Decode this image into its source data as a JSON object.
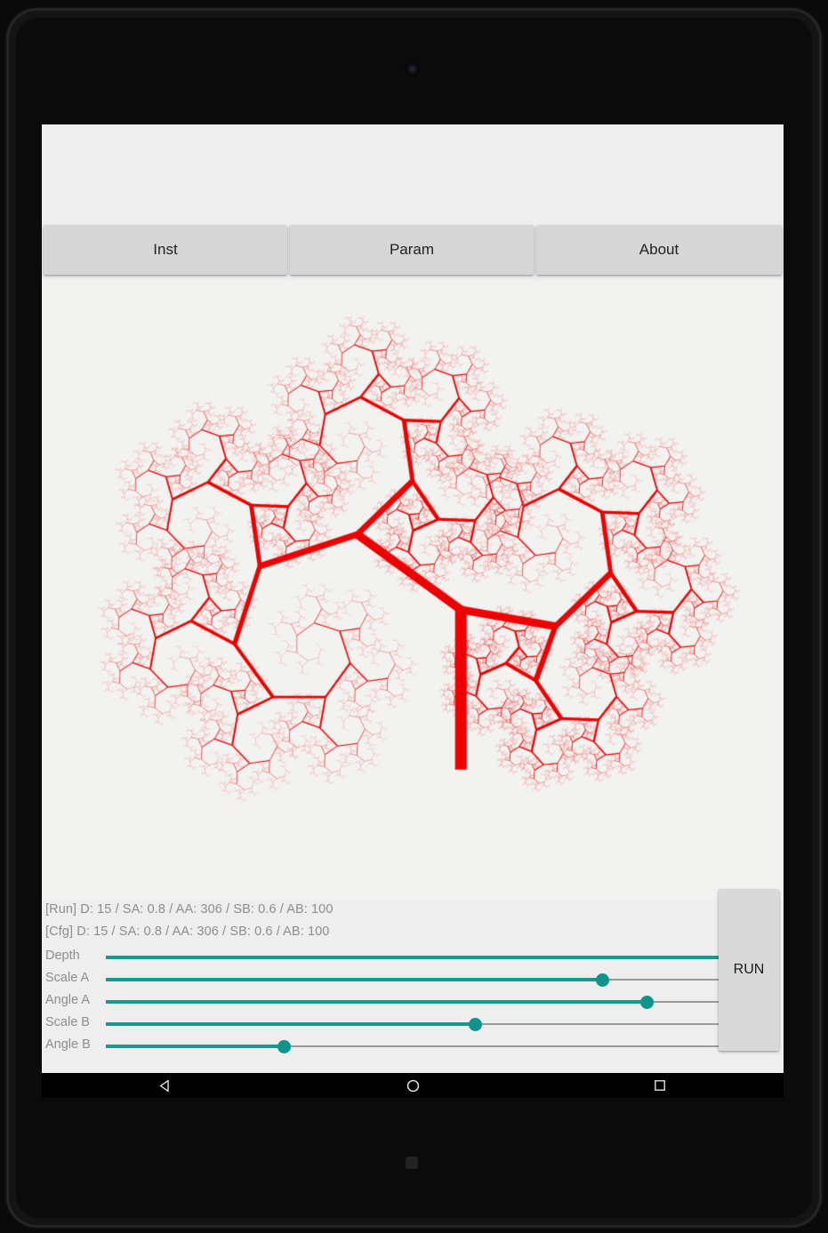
{
  "app": {
    "header_title": "",
    "tabs": [
      {
        "label": "Inst",
        "name": "tab-inst"
      },
      {
        "label": "Param",
        "name": "tab-param"
      },
      {
        "label": "About",
        "name": "tab-about"
      }
    ],
    "status": {
      "run_line": "[Run] D: 15 / SA: 0.8 / AA: 306 / SB: 0.6 / AB: 100",
      "cfg_line": "[Cfg] D: 15 / SA: 0.8 / AA: 306 / SB: 0.6 / AB: 100"
    },
    "sliders": [
      {
        "label": "Depth",
        "value": 15,
        "min": 1,
        "max": 15,
        "fill_pct": 100
      },
      {
        "label": "Scale A",
        "value": 0.8,
        "min": 0,
        "max": 1.0,
        "fill_pct": 78
      },
      {
        "label": "Angle A",
        "value": 306,
        "min": 0,
        "max": 360,
        "fill_pct": 85
      },
      {
        "label": "Scale B",
        "value": 0.6,
        "min": 0,
        "max": 1.0,
        "fill_pct": 58
      },
      {
        "label": "Angle B",
        "value": 100,
        "min": 0,
        "max": 360,
        "fill_pct": 28
      }
    ],
    "run_button_label": "RUN",
    "colors": {
      "accent": "#159a90",
      "thumb": "#0f948b",
      "button_bg": "#d6d6d6",
      "panel_bg": "#eeeeee",
      "canvas_bg": "#f2f2f0",
      "tree_color": "#ee0000",
      "status_text": "#8d8d8d"
    },
    "navbar": [
      {
        "name": "nav-back-icon",
        "glyph": "back"
      },
      {
        "name": "nav-home-icon",
        "glyph": "home"
      },
      {
        "name": "nav-recents-icon",
        "glyph": "recents"
      }
    ]
  },
  "fractal": {
    "type": "binary-branching-tree",
    "depth": 15,
    "scale_a": 0.8,
    "angle_a": 306,
    "scale_b": 0.6,
    "angle_b": 100,
    "trunk_length": 180,
    "trunk_width": 13,
    "origin_x": 0.565,
    "origin_y": 0.79,
    "color": "#ee0000",
    "background": "#f2f2f0"
  }
}
